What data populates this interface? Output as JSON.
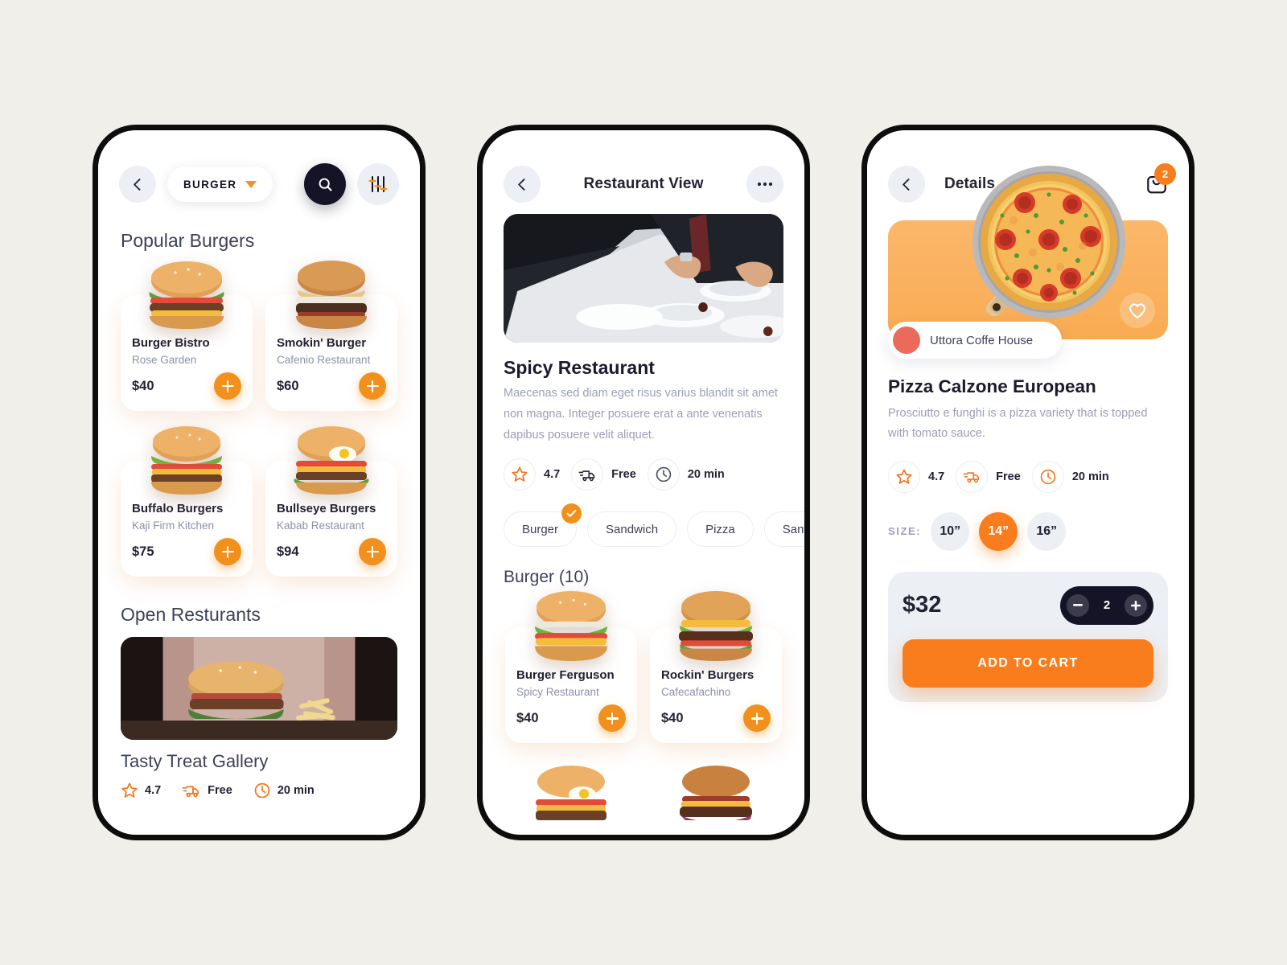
{
  "background_color": "#f0efe9",
  "accent_orange": "#f2901e",
  "accent_orange_bright": "#f97d1c",
  "dark": "#151427",
  "phone1": {
    "header": {
      "back_icon": "chevron-left-icon",
      "category_label": "BURGER",
      "caret_icon": "caret-down-icon",
      "search_icon": "search-icon",
      "filter_icon": "sliders-icon"
    },
    "popular_title": "Popular Burgers",
    "items": [
      {
        "name": "Burger Bistro",
        "restaurant": "Rose Garden",
        "price": "$40",
        "add_icon": "plus-icon"
      },
      {
        "name": "Smokin' Burger",
        "restaurant": "Cafenio Restaurant",
        "price": "$60",
        "add_icon": "plus-icon"
      },
      {
        "name": "Buffalo Burgers",
        "restaurant": "Kaji Firm Kitchen",
        "price": "$75",
        "add_icon": "plus-icon"
      },
      {
        "name": "Bullseye Burgers",
        "restaurant": "Kabab Restaurant",
        "price": "$94",
        "add_icon": "plus-icon"
      }
    ],
    "open_title": "Open Resturants",
    "restaurant": {
      "name": "Tasty Treat Gallery",
      "rating": "4.7",
      "delivery": "Free",
      "time": "20 min",
      "star_icon": "star-icon",
      "truck_icon": "delivery-truck-icon",
      "clock_icon": "clock-icon"
    }
  },
  "phone2": {
    "header": {
      "back_icon": "chevron-left-icon",
      "title": "Restaurant View",
      "more_icon": "more-dots-icon"
    },
    "restaurant_name": "Spicy Restaurant",
    "description": "Maecenas sed diam eget risus varius blandit sit amet non magna. Integer posuere erat a ante venenatis dapibus posuere velit aliquet.",
    "meta": {
      "rating": "4.7",
      "delivery": "Free",
      "time": "20 min",
      "star_icon": "star-icon",
      "truck_icon": "delivery-truck-icon",
      "clock_icon": "clock-icon"
    },
    "tabs": [
      {
        "label": "Burger",
        "selected": true,
        "check_icon": "check-icon"
      },
      {
        "label": "Sandwich",
        "selected": false
      },
      {
        "label": "Pizza",
        "selected": false
      },
      {
        "label": "Sanwich",
        "selected": false
      }
    ],
    "section_title": "Burger (10)",
    "items": [
      {
        "name": "Burger Ferguson",
        "restaurant": "Spicy Restaurant",
        "price": "$40",
        "add_icon": "plus-icon"
      },
      {
        "name": "Rockin' Burgers",
        "restaurant": "Cafecafachino",
        "price": "$40",
        "add_icon": "plus-icon"
      }
    ]
  },
  "phone3": {
    "header": {
      "back_icon": "chevron-left-icon",
      "title": "Details",
      "cart_icon": "shopping-bag-icon",
      "cart_badge": "2"
    },
    "favorite_icon": "heart-icon",
    "shop_name": "Uttora Coffe House",
    "product_title": "Pizza Calzone European",
    "product_desc": "Prosciutto e funghi is a pizza variety that is topped with tomato sauce.",
    "meta": {
      "rating": "4.7",
      "delivery": "Free",
      "time": "20 min",
      "star_icon": "star-icon",
      "truck_icon": "delivery-truck-icon",
      "clock_icon": "clock-icon"
    },
    "size_label": "SIZE:",
    "sizes": [
      {
        "label": "10”",
        "selected": false
      },
      {
        "label": "14”",
        "selected": true
      },
      {
        "label": "16”",
        "selected": false
      }
    ],
    "price": "$32",
    "quantity": "2",
    "minus_icon": "minus-icon",
    "plus_icon": "plus-icon",
    "add_to_cart_label": "ADD TO CART"
  }
}
